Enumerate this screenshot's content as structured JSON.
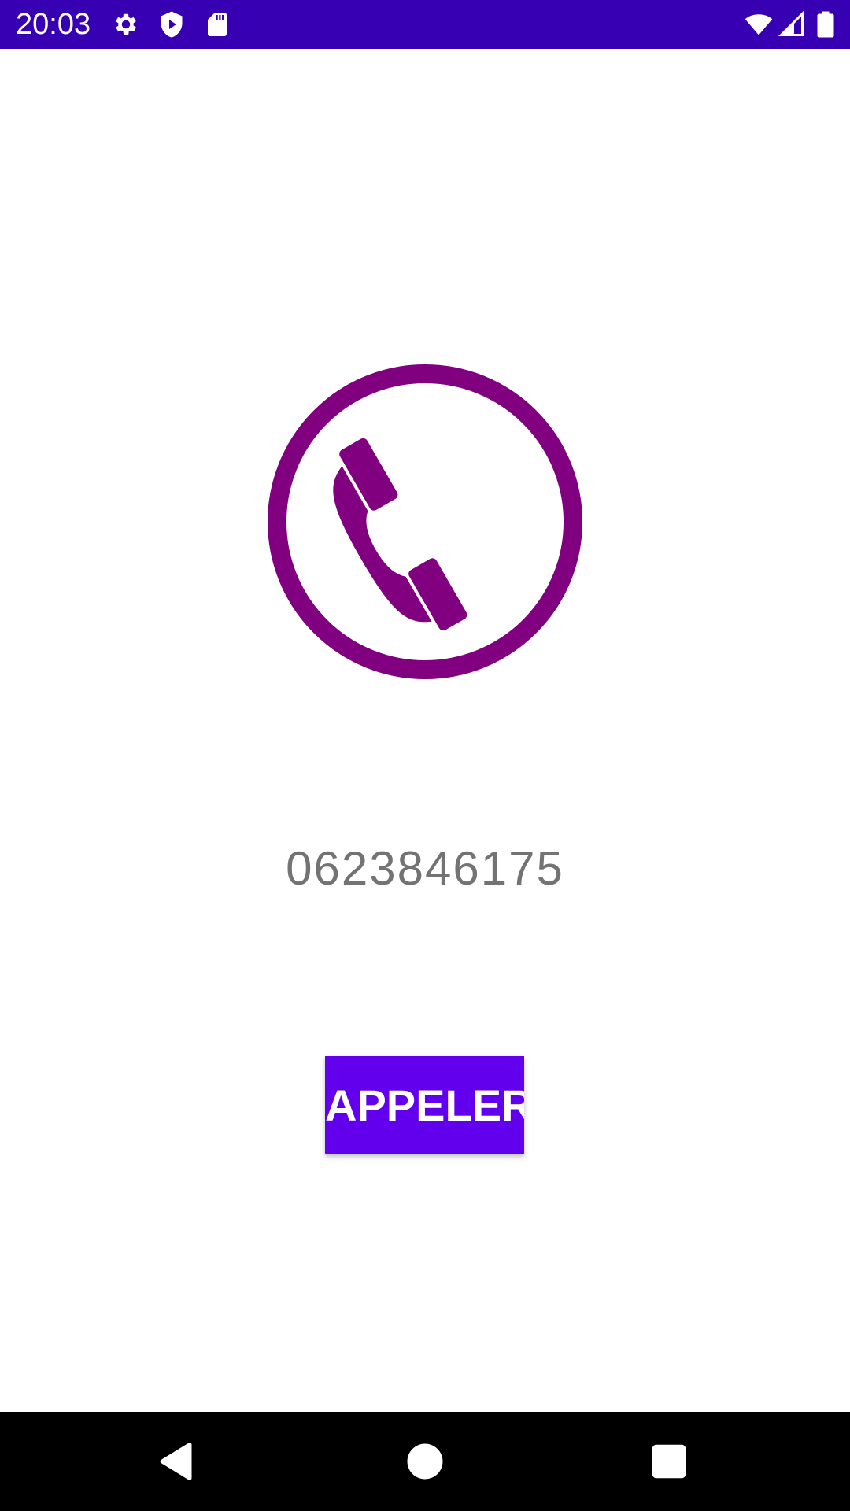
{
  "status_bar": {
    "time": "20:03",
    "background_color": "#3700b3",
    "icons_left": [
      "gear-icon",
      "shield-play-icon",
      "sd-card-icon"
    ],
    "icons_right": [
      "wifi-icon",
      "signal-icon",
      "battery-icon"
    ]
  },
  "main": {
    "illustration": "phone-handset-in-circle-icon",
    "illustration_color": "#800080",
    "phone_number": "0623846175",
    "call_button_label": "APPELER",
    "call_button_color": "#6200ee"
  },
  "nav_bar": {
    "buttons": [
      "back-icon",
      "home-icon",
      "recents-icon"
    ]
  }
}
